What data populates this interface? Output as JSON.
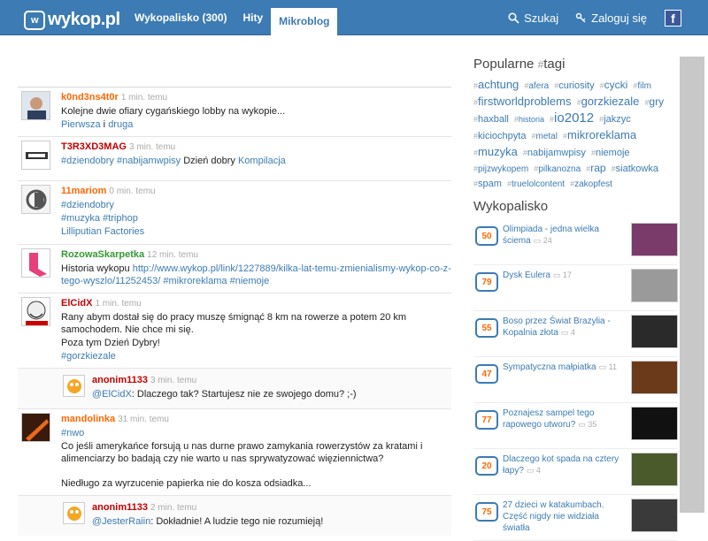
{
  "header": {
    "logo_badge": "w",
    "logo_text": "wykop.pl",
    "nav": [
      {
        "label": "Wykopalisko (300)"
      },
      {
        "label": "Hity"
      },
      {
        "label": "Mikroblog"
      }
    ],
    "search_label": "Szukaj",
    "login_label": "Zaloguj się",
    "facebook_label": "f"
  },
  "feed": {
    "entries": [
      {
        "author": "k0nd3ns4t0r",
        "time": "1 min. temu",
        "text": "Kolejne dwie ofiary cygańskiego lobby na wykopie...",
        "link1": "Pierwsza",
        "sep": " i ",
        "link2": "druga"
      },
      {
        "author": "T3R3XD3MAG",
        "time": "3 min. temu",
        "tag1": "#dziendobry",
        "tag2": "#nabijamwpisy",
        "text": " Dzień dobry ",
        "link": "Kompilacja"
      },
      {
        "author": "11mariom",
        "time": "0 min. temu",
        "tag1": "#dziendobry",
        "tag2": "#muzyka",
        "tag3": "#triphop",
        "link": "Lilliputian Factories"
      },
      {
        "author": "RozowaSkarpetka",
        "time": "12 min. temu",
        "text": "Historia wykopu ",
        "link": "http://www.wykop.pl/link/1227889/kilka-lat-temu-zmienialismy-wykop-co-z-tego-wyszlo/11252453/",
        "tag1": "#mikroreklama",
        "tag2": "#niemoje"
      },
      {
        "author": "ElCidX",
        "time": "1 min. temu",
        "line1": "Rany abym dostał się do pracy muszę śmignąć 8 km na rowerze a potem 20 km samochodem. Nie chce mi się.",
        "line2": "Poza tym Dzień Dybry!",
        "tag1": "#gorzkiezale"
      },
      {
        "author": "anonim1133",
        "time": "3 min. temu",
        "mention": "@ElCidX",
        "text": ": Dlaczego tak? Startujesz nie ze swojego domu? ;-)"
      },
      {
        "author": "mandolinka",
        "time": "31 min. temu",
        "tag1": "#nwo",
        "line1": "Co jeśli amerykańce forsują u nas durne prawo zamykania rowerzystów za kratami i alimenciarzy bo badają czy nie warto u nas sprywatyzować więziennictwa?",
        "line2": "Niedługo za wyrzucenie papierka nie do kosza odsiadka..."
      },
      {
        "author": "anonim1133",
        "time": "2 min. temu",
        "mention": "@JesterRaiin",
        "text": ": Dokładnie! A ludzie tego nie rozumieją!"
      }
    ]
  },
  "sidebar": {
    "popular_title_1": "Popularne ",
    "popular_hash": "#",
    "popular_title_2": "tagi",
    "tags": [
      {
        "text": "achtung",
        "size": 5
      },
      {
        "text": "afera",
        "size": 2
      },
      {
        "text": "curiosity",
        "size": 3
      },
      {
        "text": "cycki",
        "size": 4
      },
      {
        "text": "film",
        "size": 2
      },
      {
        "text": "firstworldproblems",
        "size": 5
      },
      {
        "text": "gorzkiezale",
        "size": 5
      },
      {
        "text": "gry",
        "size": 4
      },
      {
        "text": "haxball",
        "size": 3
      },
      {
        "text": "historia",
        "size": 1
      },
      {
        "text": "io2012",
        "size": 6
      },
      {
        "text": "jakzyc",
        "size": 3
      },
      {
        "text": "kiciochpyta",
        "size": 3
      },
      {
        "text": "metal",
        "size": 2
      },
      {
        "text": "mikroreklama",
        "size": 5
      },
      {
        "text": "muzyka",
        "size": 5
      },
      {
        "text": "nabijamwpisy",
        "size": 3
      },
      {
        "text": "niemoje",
        "size": 3
      },
      {
        "text": "pijzwykopem",
        "size": 2
      },
      {
        "text": "pilkanozna",
        "size": 2
      },
      {
        "text": "rap",
        "size": 4
      },
      {
        "text": "siatkowka",
        "size": 3
      },
      {
        "text": "spam",
        "size": 3
      },
      {
        "text": "truelolcontent",
        "size": 2
      },
      {
        "text": "zakopfest",
        "size": 2
      }
    ],
    "wykopalisko_title": "Wykopalisko",
    "items": [
      {
        "count": "50",
        "title": "Olimpiada - jedna wielka ściema",
        "comments": "24",
        "thumb": "#7a3a6a"
      },
      {
        "count": "79",
        "title": "Dysk Eulera",
        "comments": "17",
        "thumb": "#9a9a9a"
      },
      {
        "count": "55",
        "title": "Boso przez Świat Brazylia - Kopalnia złota",
        "comments": "4",
        "thumb": "#2a2a2a"
      },
      {
        "count": "47",
        "title": "Sympatyczna małpiatka",
        "comments": "11",
        "thumb": "#6a3a1a"
      },
      {
        "count": "77",
        "title": "Poznajesz sampel tego rapowego utworu?",
        "comments": "35",
        "thumb": "#111111"
      },
      {
        "count": "20",
        "title": "Dlaczego kot spada na cztery łapy?",
        "comments": "4",
        "thumb": "#4a5a2a"
      },
      {
        "count": "75",
        "title": "27 dzieci w katakumbach. Część nigdy nie widziała światła",
        "comments": "",
        "thumb": "#3a3a3a"
      }
    ]
  },
  "colors": {
    "brand": "#3c7bb3",
    "author_orange": "#ff6600",
    "author_red": "#c00000",
    "author_green": "#339933"
  }
}
